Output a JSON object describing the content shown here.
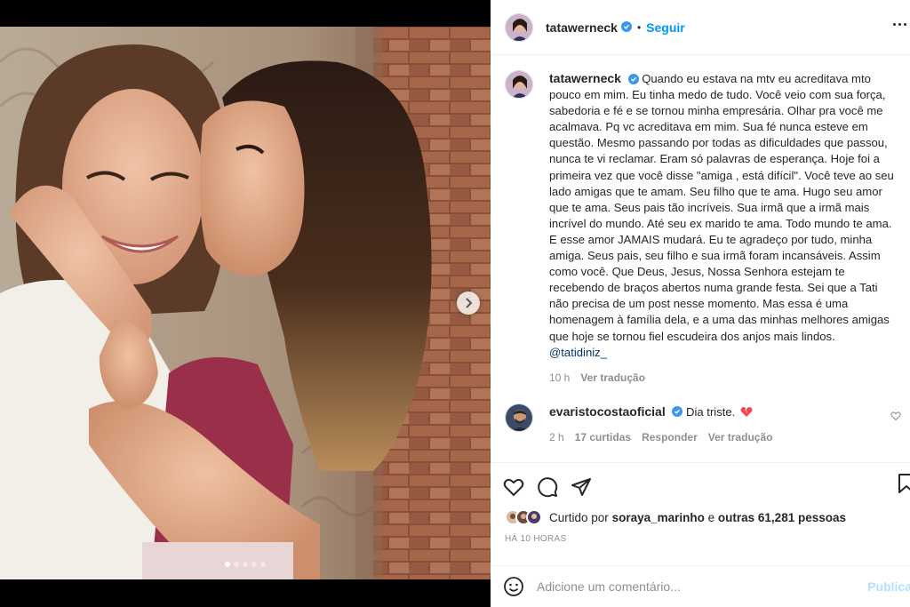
{
  "post": {
    "author": "tatawerneck",
    "follow_label": "Seguir",
    "separator": "•",
    "caption": "Quando eu estava na mtv eu acreditava mto pouco em mim. Eu tinha medo de tudo. Você veio com sua força, sabedoria e fé e se tornou minha empresária. Olhar pra você me acalmava. Pq vc acreditava em mim. Sua fé nunca esteve em questão. Mesmo passando por todas as dificuldades que passou, nunca te vi reclamar. Eram só palavras de esperança. Hoje foi a primeira vez que você disse \"amiga , está difícil\". Você teve ao seu lado amigas que te amam. Seu filho que te ama. Hugo seu amor que te ama. Seus pais tão incríveis. Sua irmã que a irmã mais incrível do mundo. Até seu ex marido te ama. Todo mundo te ama. E esse amor JAMAIS mudará. Eu te agradeço por tudo, minha amiga. Seus pais, seu filho e sua irmã foram incansáveis. Assim como você. Que Deus, Jesus, Nossa Senhora estejam te recebendo de braços abertos numa grande festa. Sei que a Tati não precisa de um post nesse momento. Mas essa é uma homenagem à família dela, e a uma das minhas melhores amigas que hoje se tornou fiel escudeira dos anjos mais lindos.",
    "mention": "@tatidiniz_",
    "caption_time": "10 h",
    "see_translation": "Ver tradução",
    "carousel": {
      "total": 5,
      "active": 0
    }
  },
  "comment": {
    "author": "evaristocostaoficial",
    "text": "Dia triste.",
    "time": "2 h",
    "likes": "17 curtidas",
    "reply": "Responder",
    "see_translation": "Ver tradução"
  },
  "likes": {
    "prefix": "Curtido por",
    "user": "soraya_marinho",
    "connector": "e",
    "others": "outras 61,281 pessoas"
  },
  "post_time": "HÁ 10 HORAS",
  "add_comment": {
    "placeholder": "Adicione um comentário...",
    "publish": "Publica"
  },
  "colors": {
    "accent": "#0095f6",
    "verified": "#3897f0",
    "heart": "#ed4956"
  },
  "icons": [
    "verified-icon",
    "more-icon",
    "heart-icon",
    "comment-icon",
    "share-icon",
    "bookmark-icon",
    "emoji-icon",
    "chevron-right-icon"
  ]
}
